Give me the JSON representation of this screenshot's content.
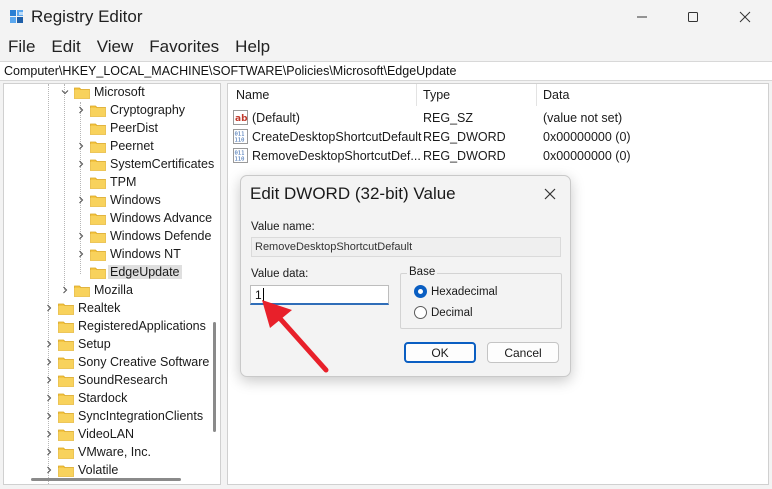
{
  "window": {
    "title": "Registry Editor",
    "controls": [
      "minimize",
      "maximize",
      "close"
    ]
  },
  "menu": [
    "File",
    "Edit",
    "View",
    "Favorites",
    "Help"
  ],
  "address": "Computer\\HKEY_LOCAL_MACHINE\\SOFTWARE\\Policies\\Microsoft\\EdgeUpdate",
  "tree": {
    "items": [
      {
        "label": "Microsoft",
        "expanded": true,
        "depth": 1
      },
      {
        "label": "Cryptography",
        "expandable": true,
        "depth": 2
      },
      {
        "label": "PeerDist",
        "expandable": false,
        "depth": 2
      },
      {
        "label": "Peernet",
        "expandable": true,
        "depth": 2
      },
      {
        "label": "SystemCertificates",
        "expandable": true,
        "depth": 2
      },
      {
        "label": "TPM",
        "expandable": false,
        "depth": 2
      },
      {
        "label": "Windows",
        "expandable": true,
        "depth": 2
      },
      {
        "label": "Windows Advance",
        "expandable": false,
        "depth": 2
      },
      {
        "label": "Windows Defende",
        "expandable": true,
        "depth": 2
      },
      {
        "label": "Windows NT",
        "expandable": true,
        "depth": 2
      },
      {
        "label": "EdgeUpdate",
        "expandable": false,
        "depth": 2,
        "selected": true
      },
      {
        "label": "Mozilla",
        "expandable": true,
        "depth": 1
      },
      {
        "label": "Realtek",
        "expandable": true,
        "depth": 0
      },
      {
        "label": "RegisteredApplications",
        "expandable": false,
        "depth": 0
      },
      {
        "label": "Setup",
        "expandable": true,
        "depth": 0
      },
      {
        "label": "Sony Creative Software",
        "expandable": true,
        "depth": 0
      },
      {
        "label": "SoundResearch",
        "expandable": true,
        "depth": 0
      },
      {
        "label": "Stardock",
        "expandable": true,
        "depth": 0
      },
      {
        "label": "SyncIntegrationClients",
        "expandable": true,
        "depth": 0
      },
      {
        "label": "VideoLAN",
        "expandable": true,
        "depth": 0
      },
      {
        "label": "VMware, Inc.",
        "expandable": true,
        "depth": 0
      },
      {
        "label": "Volatile",
        "expandable": true,
        "depth": 0
      }
    ]
  },
  "list": {
    "columns": [
      "Name",
      "Type",
      "Data"
    ],
    "rows": [
      {
        "icon": "string-value-icon",
        "name": "(Default)",
        "type": "REG_SZ",
        "data": "(value not set)"
      },
      {
        "icon": "binary-value-icon",
        "name": "CreateDesktopShortcutDefault",
        "type": "REG_DWORD",
        "data": "0x00000000 (0)"
      },
      {
        "icon": "binary-value-icon",
        "name": "RemoveDesktopShortcutDef...",
        "type": "REG_DWORD",
        "data": "0x00000000 (0)"
      }
    ]
  },
  "dialog": {
    "title": "Edit DWORD (32-bit) Value",
    "value_name_label": "Value name:",
    "value_name": "RemoveDesktopShortcutDefault",
    "value_data_label": "Value data:",
    "value_data": "1",
    "base_label": "Base",
    "base_options": [
      {
        "label": "Hexadecimal",
        "checked": true
      },
      {
        "label": "Decimal",
        "checked": false
      }
    ],
    "ok_label": "OK",
    "cancel_label": "Cancel"
  },
  "colors": {
    "accent": "#0a5ec2",
    "folder": "#f4c542",
    "annotation_arrow": "#e8202a"
  }
}
